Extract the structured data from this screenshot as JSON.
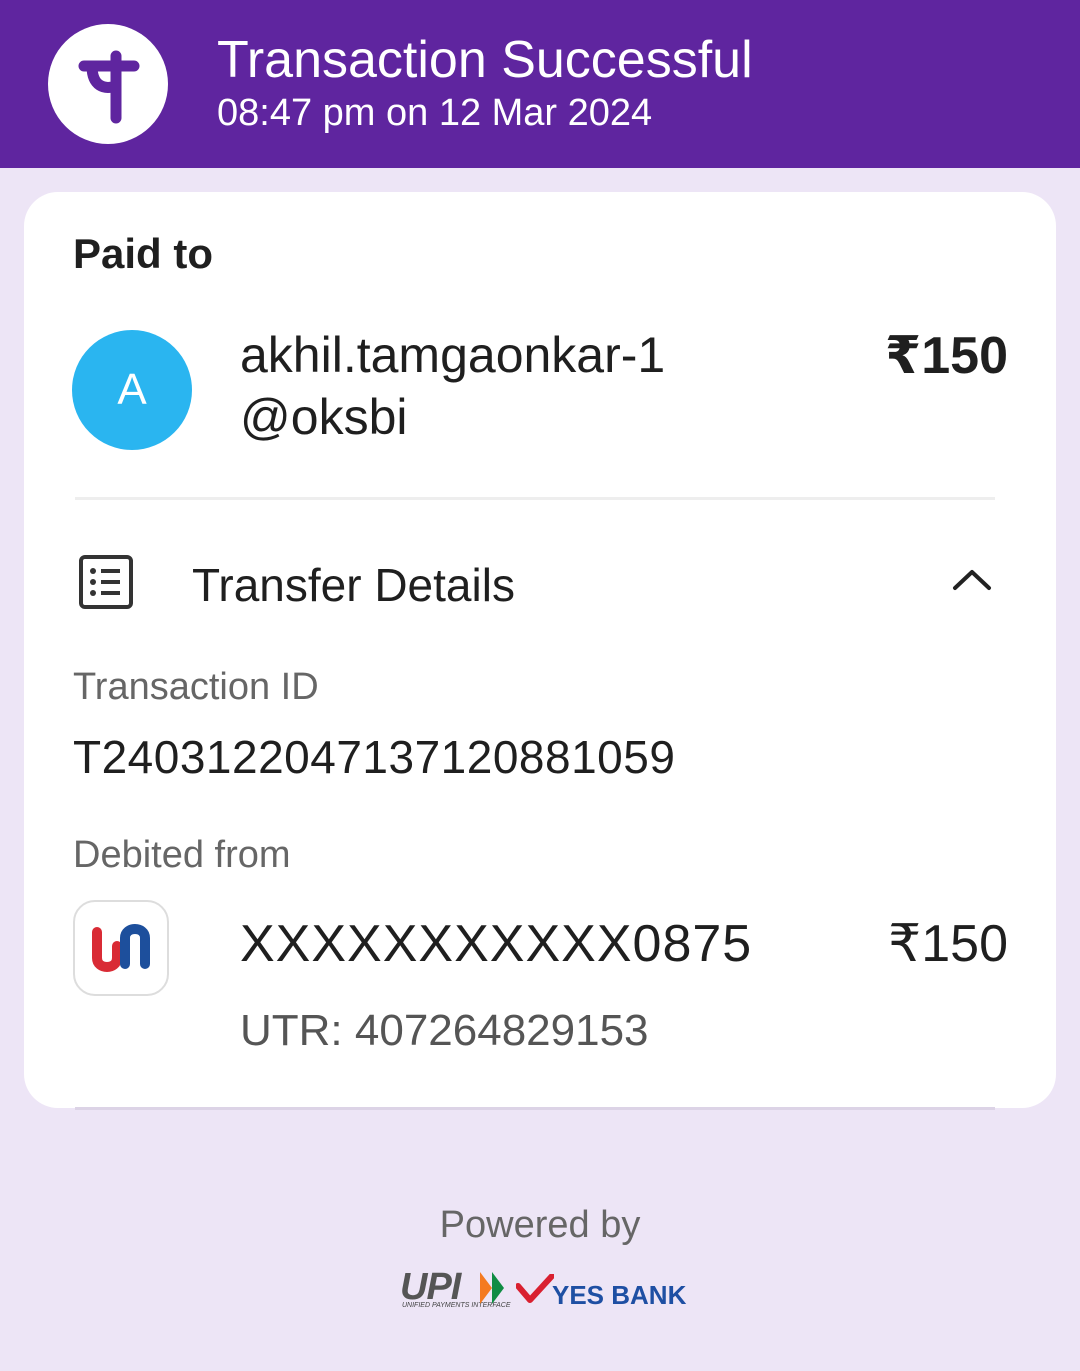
{
  "header": {
    "title": "Transaction Successful",
    "datetime": "08:47 pm on 12 Mar 2024",
    "brand_color": "#5f259f",
    "logo_icon": "phonepe-logo-icon"
  },
  "payment": {
    "section_label": "Paid to",
    "avatar_letter": "A",
    "avatar_color": "#2ab5f0",
    "payee_upi": "akhil.tamgaonkar-1@oksbi",
    "amount": "₹150"
  },
  "transfer_details": {
    "title": "Transfer Details",
    "icon": "receipt-list-icon",
    "expanded": true,
    "transaction_id_label": "Transaction ID",
    "transaction_id": "T2403122047137120881059",
    "debited_from_label": "Debited from",
    "bank_icon": "union-bank-logo-icon",
    "account": "XXXXXXXXXXX0875",
    "amount": "₹150",
    "utr": "UTR: 407264829153"
  },
  "footer": {
    "powered_by": "Powered by",
    "upi_label": "UPI",
    "upi_subtitle": "UNIFIED PAYMENTS INTERFACE",
    "bank_label": "YES BANK"
  }
}
